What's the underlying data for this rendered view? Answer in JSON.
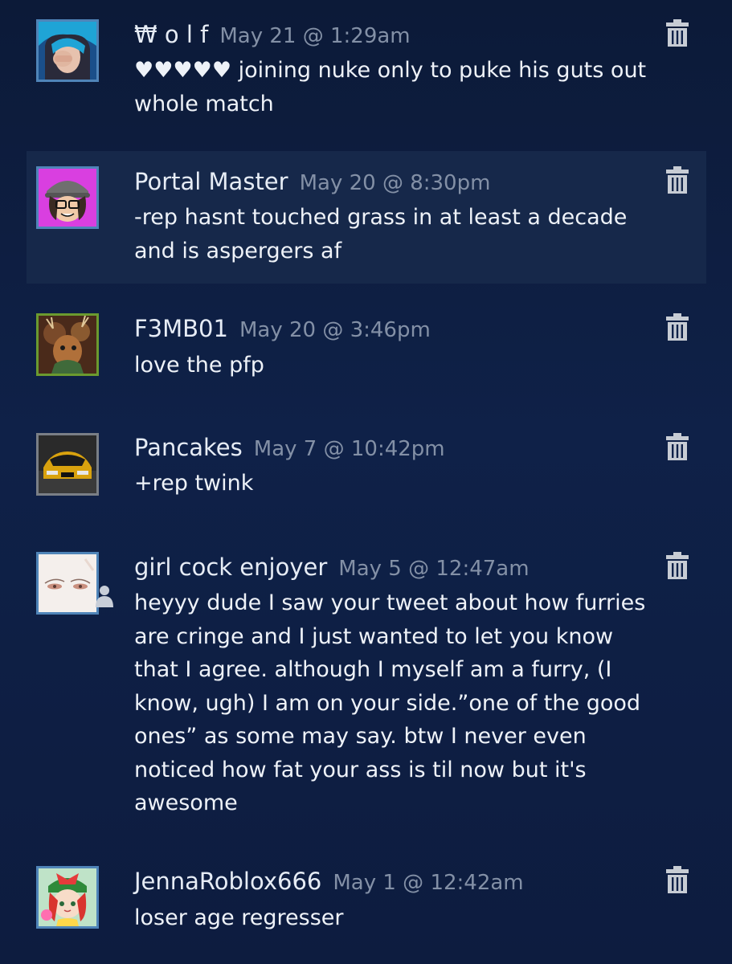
{
  "comments": [
    {
      "author": "₩ o l f",
      "timestamp": "May 21 @ 1:29am",
      "text": "♥♥♥♥♥ joining nuke only to puke his guts out whole match",
      "delete_icon": "trash-icon"
    },
    {
      "author": "Portal Master",
      "timestamp": "May 20 @ 8:30pm",
      "text": "-rep hasnt touched grass in at least a decade and is aspergers af",
      "delete_icon": "trash-icon"
    },
    {
      "author": "F3MB01",
      "timestamp": "May 20 @ 3:46pm",
      "text": "love the pfp",
      "delete_icon": "trash-icon"
    },
    {
      "author": "Pancakes",
      "timestamp": "May 7 @ 10:42pm",
      "text": "+rep twink",
      "delete_icon": "trash-icon"
    },
    {
      "author": "girl cock enjoyer",
      "timestamp": "May 5 @ 12:47am",
      "text": "heyyy dude I saw your tweet about how furries are cringe and I just wanted to let you know that I agree. although I myself am a furry, (I know, ugh) I am on your side.”one of the good ones” as some may say. btw I never even noticed how fat your ass is til now but it's awesome",
      "delete_icon": "trash-icon"
    },
    {
      "author": "JennaRoblox666",
      "timestamp": "May 1 @ 12:42am",
      "text": "loser age regresser",
      "delete_icon": "trash-icon"
    }
  ],
  "colors": {
    "background": "#0f2148",
    "highlight_row": "#16284a",
    "author_text": "#e6ecf5",
    "timestamp_text": "#8390a6",
    "avatar_border_default": "#4f84b8",
    "avatar_border_green": "#6b9a2f"
  }
}
